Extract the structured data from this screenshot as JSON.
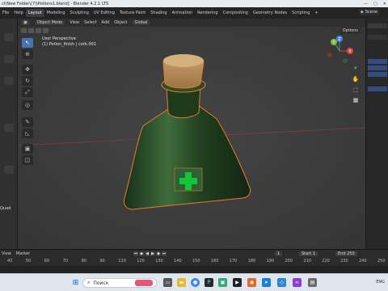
{
  "window": {
    "title": "ct\\New Folder\\(7)\\Potions1.blend] - Blender 4.2.1 LTS"
  },
  "menubar": {
    "items": [
      "File",
      "Help"
    ],
    "workspaces": [
      "Layout",
      "Modeling",
      "Sculpting",
      "UV Editing",
      "Texture Paint",
      "Shading",
      "Animation",
      "Rendering",
      "Compositing",
      "Geometry Nodes",
      "Scripting"
    ],
    "active_workspace": "Layout",
    "add_tab": "+",
    "scene_label": "Scene"
  },
  "viewport_header": {
    "mode": "Object Mode",
    "menus": [
      "View",
      "Select",
      "Add",
      "Object"
    ],
    "transform": "Global",
    "options": "Options"
  },
  "overlay": {
    "perspective": "User Perspective",
    "collection": "(1) Potion_finish | cork.001"
  },
  "left_panel": {
    "quad_label": "Quad"
  },
  "gizmo": {
    "x": "X",
    "y": "Y",
    "z": "Z"
  },
  "timeline": {
    "menus": [
      "View",
      "Marker"
    ],
    "frame_ticks": [
      "40",
      "50",
      "60",
      "70",
      "80",
      "90",
      "110",
      "120",
      "130",
      "140",
      "150",
      "160",
      "170",
      "180",
      "190",
      "200",
      "210",
      "220",
      "230",
      "240",
      "250"
    ],
    "current_frame": "1",
    "start_label": "Start",
    "start_value": "1",
    "end_label": "End",
    "end_value": "250"
  },
  "taskbar": {
    "search_placeholder": "Поиск",
    "lang": "ENG"
  },
  "colors": {
    "accent": "#4772b3",
    "bottle_glass": "#1f3a1c",
    "cork": "#b48c5a",
    "outline": "#e87a2a"
  }
}
